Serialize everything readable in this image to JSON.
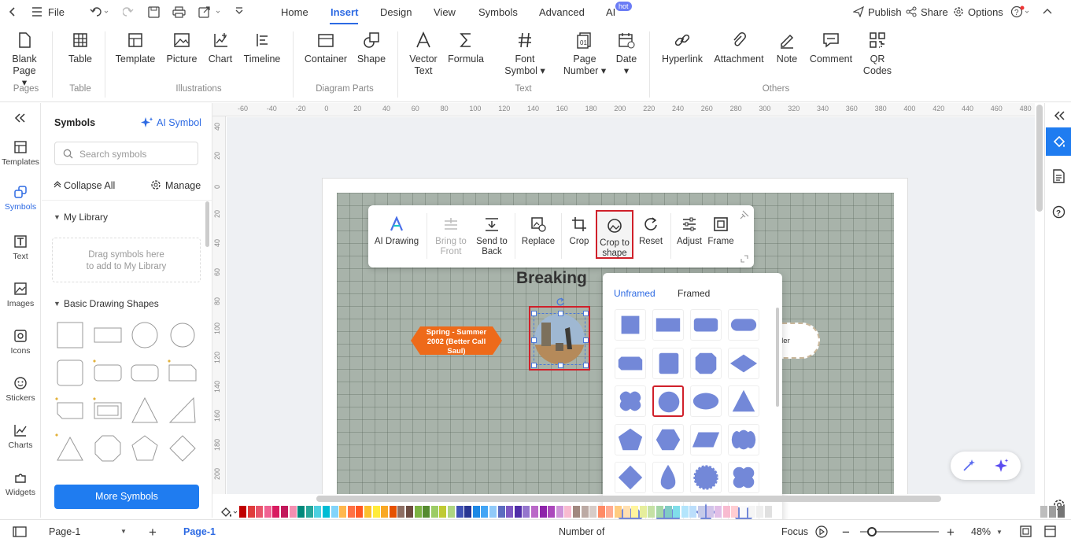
{
  "menubar": {
    "file": "File",
    "tabs": [
      "Home",
      "Insert",
      "Design",
      "View",
      "Symbols",
      "Advanced",
      "AI"
    ],
    "active_tab": "Insert",
    "hot_badge": "hot",
    "publish": "Publish",
    "share": "Share",
    "options": "Options"
  },
  "ribbon": {
    "blank_page": [
      "Blank",
      "Page"
    ],
    "table": "Table",
    "template": "Template",
    "picture": "Picture",
    "chart": "Chart",
    "timeline": "Timeline",
    "container": "Container",
    "shape": "Shape",
    "vector_text": [
      "Vector",
      "Text"
    ],
    "formula": "Formula",
    "font_symbol": [
      "Font",
      "Symbol"
    ],
    "page_number": [
      "Page",
      "Number"
    ],
    "date": "Date",
    "hyperlink": "Hyperlink",
    "attachment": "Attachment",
    "note": "Note",
    "comment": "Comment",
    "qr_codes": [
      "QR",
      "Codes"
    ],
    "groups": {
      "pages": "Pages",
      "table": "Table",
      "illustrations": "Illustrations",
      "diagram_parts": "Diagram Parts",
      "text": "Text",
      "others": "Others"
    }
  },
  "leftbar": {
    "items": [
      "Templates",
      "Symbols",
      "Text",
      "Images",
      "Icons",
      "Stickers",
      "Charts",
      "Widgets"
    ],
    "active": "Symbols"
  },
  "symbols_panel": {
    "title": "Symbols",
    "ai_symbol": "AI Symbol",
    "search_placeholder": "Search symbols",
    "collapse_all": "Collapse All",
    "manage": "Manage",
    "my_library": "My Library",
    "library_hint": [
      "Drag symbols here",
      "to add to My Library"
    ],
    "basic_shapes": "Basic Drawing Shapes",
    "more_symbols": "More Symbols"
  },
  "rulers": {
    "h_ticks": [
      "-60",
      "-40",
      "-20",
      "0",
      "20",
      "40",
      "60",
      "80",
      "100",
      "120",
      "140",
      "160",
      "180",
      "200",
      "220",
      "240",
      "260",
      "280",
      "300",
      "320",
      "340",
      "360",
      "380",
      "400",
      "420",
      "440",
      "460",
      "480"
    ],
    "v_ticks": [
      "40",
      "20",
      "0",
      "20",
      "40",
      "60",
      "80",
      "100",
      "120",
      "140",
      "160",
      "180",
      "200"
    ]
  },
  "canvas": {
    "title_fragment": "Breaking",
    "orange_label": "Spring - Summer 2002 (Better Call Saul)",
    "right_label_fragment": "der"
  },
  "image_toolbar": {
    "ai_drawing": "AI Drawing",
    "bring_to_front": [
      "Bring to",
      "Front"
    ],
    "send_to_back": [
      "Send to",
      "Back"
    ],
    "replace": "Replace",
    "crop": "Crop",
    "crop_to_shape": [
      "Crop to",
      "shape"
    ],
    "reset": "Reset",
    "adjust": "Adjust",
    "frame": "Frame"
  },
  "crop_dropdown": {
    "tabs": [
      "Unframed",
      "Framed"
    ],
    "active_tab": "Unframed",
    "shape_color": "#7388d8",
    "selected_shape": "circle"
  },
  "status": {
    "page_selector": "Page-1",
    "page_tab": "Page-1",
    "number_of": "Number of",
    "focus": "Focus",
    "zoom": "48%"
  },
  "accent": "#2d6ae3",
  "highlight": "#d0202a"
}
